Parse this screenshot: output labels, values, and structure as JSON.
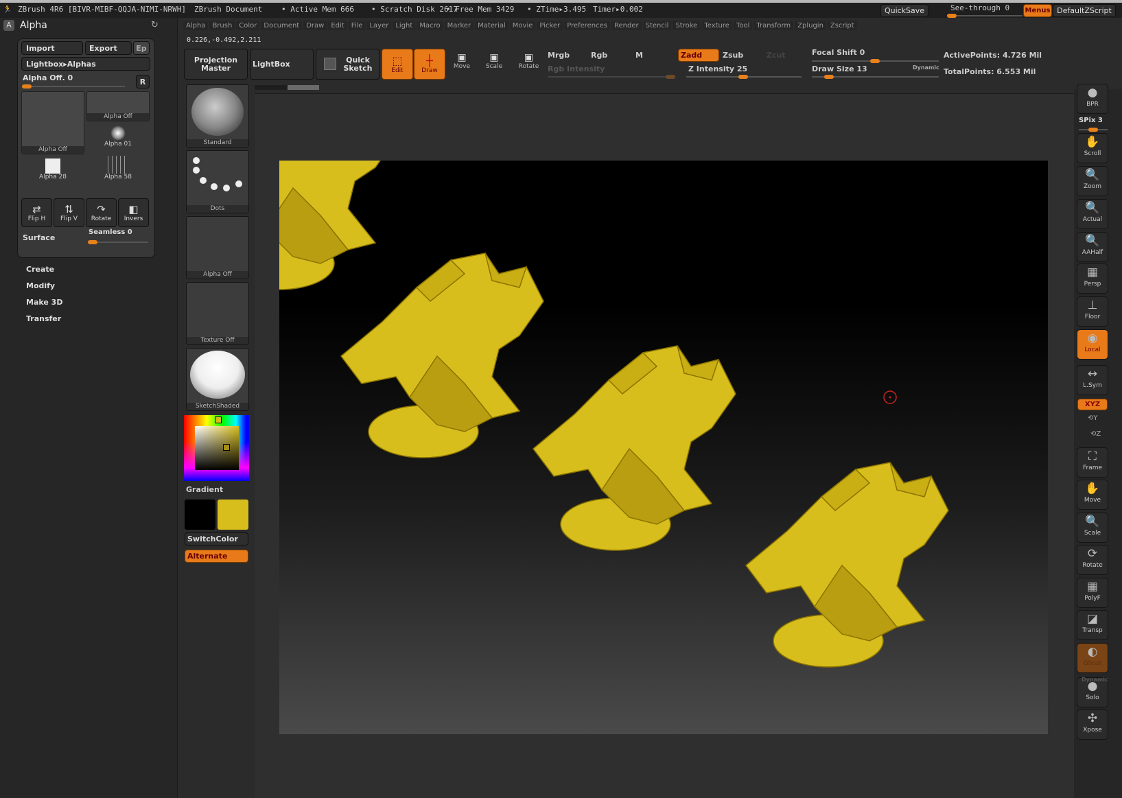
{
  "title_bar": {
    "app": "ZBrush 4R6 [BIVR-MIBF-QQJA-NIMI-NRWH]",
    "document": "ZBrush Document",
    "active_mem": "• Active Mem 666",
    "scratch_disk": "• Scratch Disk 2617",
    "free_mem": "• Free Mem 3429",
    "ztime": "• ZTime▸3.495",
    "timer": "Timer▸0.002",
    "quicksave": "QuickSave",
    "see_through": "See-through  0",
    "see_through_value": 0,
    "menus": "Menus",
    "script": "DefaultZScript"
  },
  "palette": {
    "title": "Alpha",
    "import": "Import",
    "export": "Export",
    "ep": "Ep",
    "lightbox": "Lightbox▸Alphas",
    "alpha_off_label": "Alpha Off. 0",
    "alpha_off_value": 0,
    "r": "R",
    "cells": [
      "Alpha Off",
      "Alpha Off",
      "Alpha 01",
      "Alpha 28",
      "Alpha 58"
    ],
    "buttons": [
      "Flip H",
      "Flip V",
      "Rotate",
      "Invers"
    ],
    "surface": "Surface",
    "seamless": "Seamless 0",
    "seamless_value": 0,
    "subpalettes": [
      "Create",
      "Modify",
      "Make 3D",
      "Transfer"
    ]
  },
  "menubar": [
    "Alpha",
    "Brush",
    "Color",
    "Document",
    "Draw",
    "Edit",
    "File",
    "Layer",
    "Light",
    "Macro",
    "Marker",
    "Material",
    "Movie",
    "Picker",
    "Preferences",
    "Render",
    "Stencil",
    "Stroke",
    "Texture",
    "Tool",
    "Transform",
    "Zplugin",
    "Zscript"
  ],
  "coords": "0.226,-0.492,2.211",
  "toolbar": {
    "projection_master": "Projection Master",
    "lightbox": "LightBox",
    "quick_sketch": "Quick Sketch",
    "edit": "Edit",
    "draw": "Draw",
    "move": "Move",
    "scale": "Scale",
    "rotate": "Rotate",
    "mrgb": "Mrgb",
    "rgb": "Rgb",
    "m": "M",
    "rgb_intensity": "Rgb Intensity",
    "zadd": "Zadd",
    "zsub": "Zsub",
    "zcut": "Zcut",
    "z_intensity": "Z Intensity 25",
    "z_intensity_value": 25,
    "focal_shift": "Focal Shift 0",
    "focal_shift_value": 0,
    "draw_size": "Draw Size 13",
    "draw_size_value": 13,
    "dynamic": "Dynamic",
    "active_points": "ActivePoints: 4.726 Mil",
    "total_points": "TotalPoints: 6.553 Mil"
  },
  "brush_column": {
    "brush": "Standard",
    "stroke": "Dots",
    "alpha": "Alpha Off",
    "texture": "Texture Off",
    "material": "SketchShaded",
    "gradient": "Gradient",
    "switch_color": "SwitchColor",
    "alternate": "Alternate",
    "main_color": "#d8be1c",
    "secondary_color": "#000000"
  },
  "right_shelf": [
    {
      "label": "BPR",
      "icon": "bpr-sphere-icon"
    },
    {
      "label": "Scroll",
      "icon": "hand-icon"
    },
    {
      "label": "Zoom",
      "icon": "zoom-icon"
    },
    {
      "label": "Actual",
      "icon": "magnify-x1-icon"
    },
    {
      "label": "AAHalf",
      "icon": "magnify-half-icon"
    },
    {
      "label": "Persp",
      "icon": "perspective-grid-icon"
    },
    {
      "label": "Floor",
      "icon": "floor-icon"
    },
    {
      "label": "Local",
      "icon": "local-rotate-icon",
      "active": true
    },
    {
      "label": "L.Sym",
      "icon": "local-symmetry-icon"
    },
    {
      "label": "Frame",
      "icon": "frame-icon"
    },
    {
      "label": "Move",
      "icon": "move-hand-icon"
    },
    {
      "label": "Scale",
      "icon": "scale-icon"
    },
    {
      "label": "Rotate",
      "icon": "rotate-icon"
    },
    {
      "label": "PolyF",
      "icon": "polyframe-icon"
    },
    {
      "label": "Transp",
      "icon": "transparency-icon"
    },
    {
      "label": "Ghost",
      "icon": "ghost-icon",
      "active": true
    },
    {
      "label": "Solo",
      "icon": "solo-icon"
    },
    {
      "label": "Xpose",
      "icon": "xpose-icon"
    }
  ],
  "right_extra": {
    "spix": "SPix 3",
    "spix_value": 3,
    "xyz": "XYZ",
    "y": "Y",
    "z": "Z",
    "dynamic": "Dynamic"
  },
  "colors": {
    "accent": "#e87a1a",
    "model": "#d8be1c"
  }
}
